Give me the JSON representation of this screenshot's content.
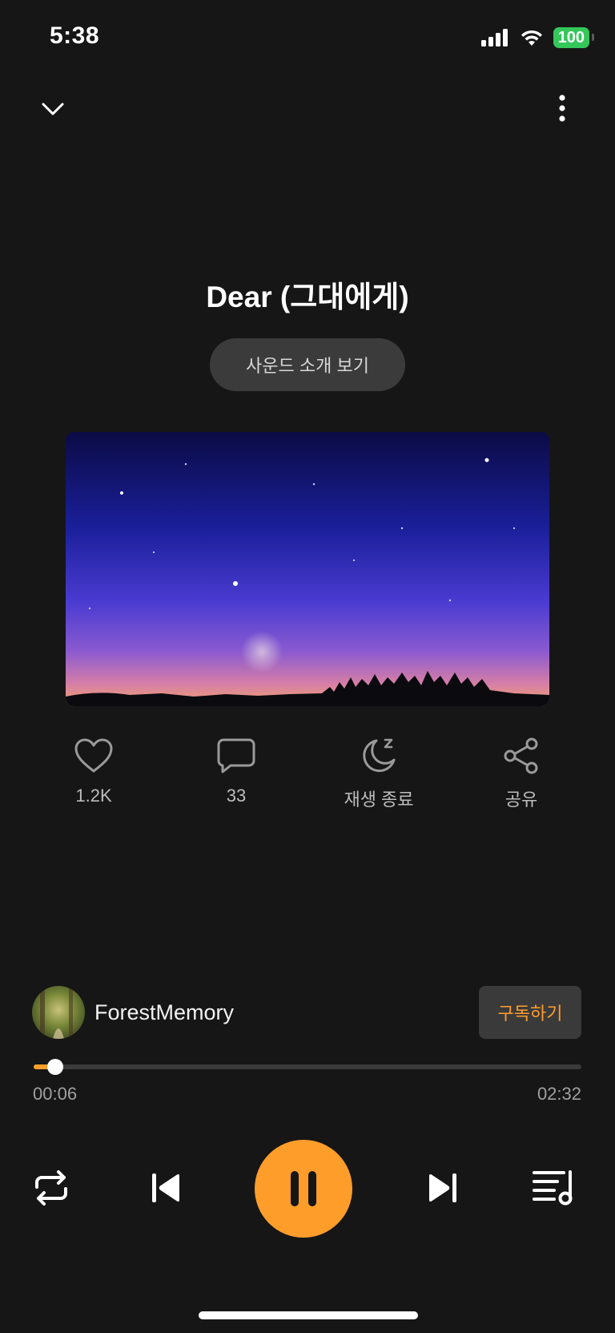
{
  "status_bar": {
    "time": "5:38",
    "battery": "100",
    "icons": [
      "signal-icon",
      "wifi-icon",
      "battery-icon"
    ]
  },
  "header": {
    "collapse_icon": "chevron-down-icon",
    "more_icon": "more-vertical-icon"
  },
  "track": {
    "title": "Dear (그대에게)",
    "intro_button": "사운드 소개 보기",
    "artwork": "night-sky-crescent-moon"
  },
  "actions": [
    {
      "icon": "heart-icon",
      "label": "1.2K"
    },
    {
      "icon": "comment-icon",
      "label": "33"
    },
    {
      "icon": "sleep-timer-icon",
      "label": "재생 종료"
    },
    {
      "icon": "share-icon",
      "label": "공유"
    }
  ],
  "creator": {
    "name": "ForestMemory",
    "subscribe_label": "구독하기"
  },
  "player": {
    "current_time": "00:06",
    "total_time": "02:32",
    "progress": 0.04,
    "state": "playing"
  },
  "colors": {
    "background": "#161616",
    "accent": "#ff9d2b",
    "battery": "#34c759"
  }
}
